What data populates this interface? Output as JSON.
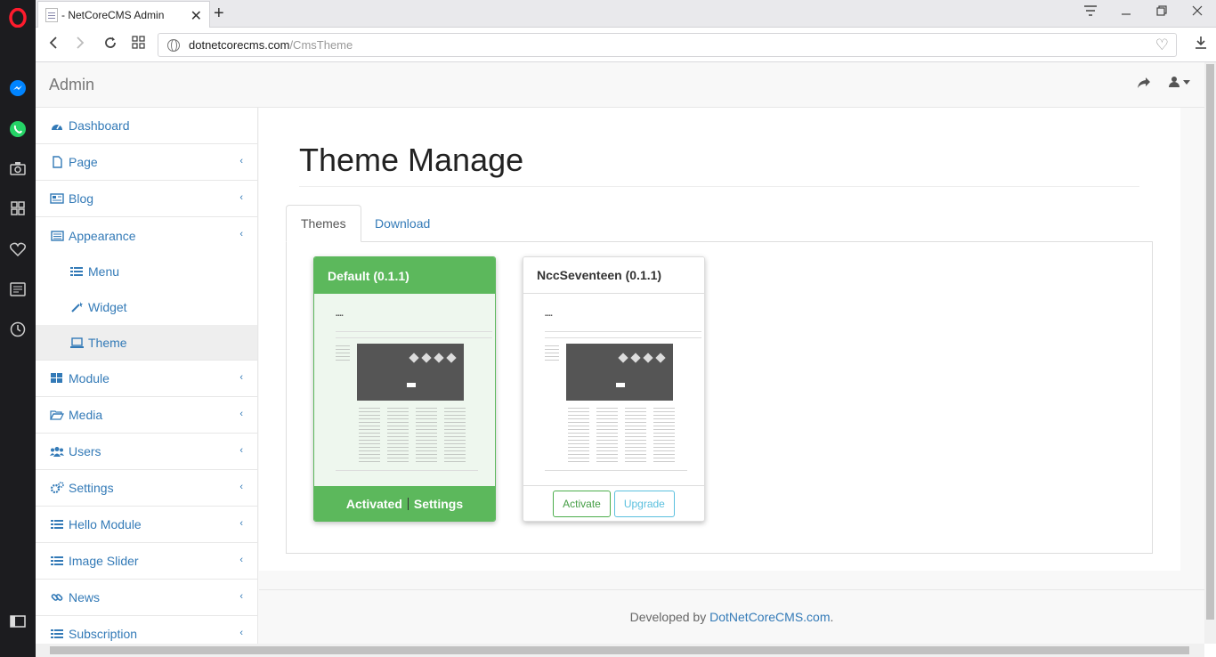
{
  "browser": {
    "tab_title": "- NetCoreCMS Admin",
    "url_domain": "dotnetcorecms.com",
    "url_path": "/CmsTheme"
  },
  "header": {
    "brand": "Admin"
  },
  "sidebar": {
    "items": [
      {
        "label": "Dashboard",
        "icon": "dashboard-icon",
        "has_chevron": false
      },
      {
        "label": "Page",
        "icon": "file-icon",
        "has_chevron": true
      },
      {
        "label": "Blog",
        "icon": "newspaper-icon",
        "has_chevron": true
      },
      {
        "label": "Appearance",
        "icon": "list-alt-icon",
        "has_chevron": true
      },
      {
        "label": "Menu",
        "icon": "list-icon",
        "sub": true
      },
      {
        "label": "Widget",
        "icon": "magic-icon",
        "sub": true
      },
      {
        "label": "Theme",
        "icon": "laptop-icon",
        "sub": true,
        "active": true
      },
      {
        "label": "Module",
        "icon": "th-large-icon",
        "has_chevron": true
      },
      {
        "label": "Media",
        "icon": "folder-open-icon",
        "has_chevron": true
      },
      {
        "label": "Users",
        "icon": "users-icon",
        "has_chevron": true
      },
      {
        "label": "Settings",
        "icon": "cogs-icon",
        "has_chevron": true
      },
      {
        "label": "Hello Module",
        "icon": "list-icon",
        "has_chevron": true
      },
      {
        "label": "Image Slider",
        "icon": "list-icon",
        "has_chevron": true
      },
      {
        "label": "News",
        "icon": "link-icon",
        "has_chevron": true
      },
      {
        "label": "Subscription",
        "icon": "list-icon",
        "has_chevron": true
      }
    ]
  },
  "main": {
    "title": "Theme Manage",
    "tabs": [
      {
        "label": "Themes",
        "active": true
      },
      {
        "label": "Download",
        "active": false
      }
    ],
    "themes": [
      {
        "name": "Default (0.1.1)",
        "status": "active",
        "footer_activated": "Activated",
        "footer_settings": "Settings"
      },
      {
        "name": "NccSeventeen (0.1.1)",
        "status": "inactive",
        "activate_label": "Activate",
        "upgrade_label": "Upgrade"
      }
    ]
  },
  "footer": {
    "prefix": "Developed by ",
    "link": "DotNetCoreCMS.com",
    "suffix": "."
  },
  "colors": {
    "opera_sidebar": "#1c1c1f",
    "link_blue": "#337ab7",
    "success_green": "#5cb85c",
    "info_blue": "#5bc0de"
  }
}
